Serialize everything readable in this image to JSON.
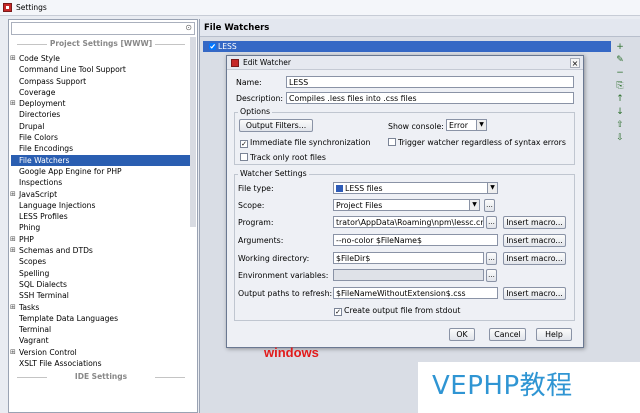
{
  "window": {
    "title": "Settings"
  },
  "left": {
    "search_placeholder": "",
    "project_settings_header": "Project Settings [WWW]",
    "ide_settings_header": "IDE Settings",
    "items": [
      {
        "label": "Code Style",
        "expandable": true
      },
      {
        "label": "Command Line Tool Support",
        "expandable": false
      },
      {
        "label": "Compass Support",
        "expandable": false
      },
      {
        "label": "Coverage",
        "expandable": false
      },
      {
        "label": "Deployment",
        "expandable": true
      },
      {
        "label": "Directories",
        "expandable": false
      },
      {
        "label": "Drupal",
        "expandable": false
      },
      {
        "label": "File Colors",
        "expandable": false
      },
      {
        "label": "File Encodings",
        "expandable": false
      },
      {
        "label": "File Watchers",
        "expandable": false,
        "selected": true
      },
      {
        "label": "Google App Engine for PHP",
        "expandable": false
      },
      {
        "label": "Inspections",
        "expandable": false
      },
      {
        "label": "JavaScript",
        "expandable": true
      },
      {
        "label": "Language Injections",
        "expandable": false
      },
      {
        "label": "LESS Profiles",
        "expandable": false
      },
      {
        "label": "Phing",
        "expandable": false
      },
      {
        "label": "PHP",
        "expandable": true
      },
      {
        "label": "Schemas and DTDs",
        "expandable": true
      },
      {
        "label": "Scopes",
        "expandable": false
      },
      {
        "label": "Spelling",
        "expandable": false
      },
      {
        "label": "SQL Dialects",
        "expandable": false
      },
      {
        "label": "SSH Terminal",
        "expandable": false
      },
      {
        "label": "Tasks",
        "expandable": true
      },
      {
        "label": "Template Data Languages",
        "expandable": false
      },
      {
        "label": "Terminal",
        "expandable": false
      },
      {
        "label": "Vagrant",
        "expandable": false
      },
      {
        "label": "Version Control",
        "expandable": true
      },
      {
        "label": "XSLT File Associations",
        "expandable": false
      }
    ]
  },
  "right": {
    "title": "File Watchers",
    "watcher_name": "LESS",
    "tools": [
      "+",
      "✎",
      "−",
      "⎘",
      "↑",
      "↓",
      "⇧",
      "⇩"
    ]
  },
  "dialog": {
    "title": "Edit Watcher",
    "name_label": "Name:",
    "name_value": "LESS",
    "description_label": "Description:",
    "description_value": "Compiles .less files into .css files",
    "options_legend": "Options",
    "output_filters_button": "Output Filters...",
    "show_console_label": "Show console:",
    "show_console_value": "Error",
    "immediate_sync_label": "Immediate file synchronization",
    "trigger_regardless_label": "Trigger watcher regardless of syntax errors",
    "track_root_label": "Track only root files",
    "watcher_settings_legend": "Watcher Settings",
    "file_type_label": "File type:",
    "file_type_value": "LESS files",
    "scope_label": "Scope:",
    "scope_value": "Project Files",
    "program_label": "Program:",
    "program_value": "trator\\AppData\\Roaming\\npm\\lessc.cmd",
    "arguments_label": "Arguments:",
    "arguments_value": "--no-color $FileName$",
    "working_dir_label": "Working directory:",
    "working_dir_value": "$FileDir$",
    "env_label": "Environment variables:",
    "env_value": "",
    "output_paths_label": "Output paths to refresh:",
    "output_paths_value": "$FileNameWithoutExtension$.css",
    "create_output_label": "Create output file from stdout",
    "insert_macro": "Insert macro...",
    "ellipsis": "...",
    "ok": "OK",
    "cancel": "Cancel",
    "help": "Help"
  },
  "annotation": {
    "windows": "windows"
  },
  "watermark": {
    "text": "VEPHP教程"
  }
}
